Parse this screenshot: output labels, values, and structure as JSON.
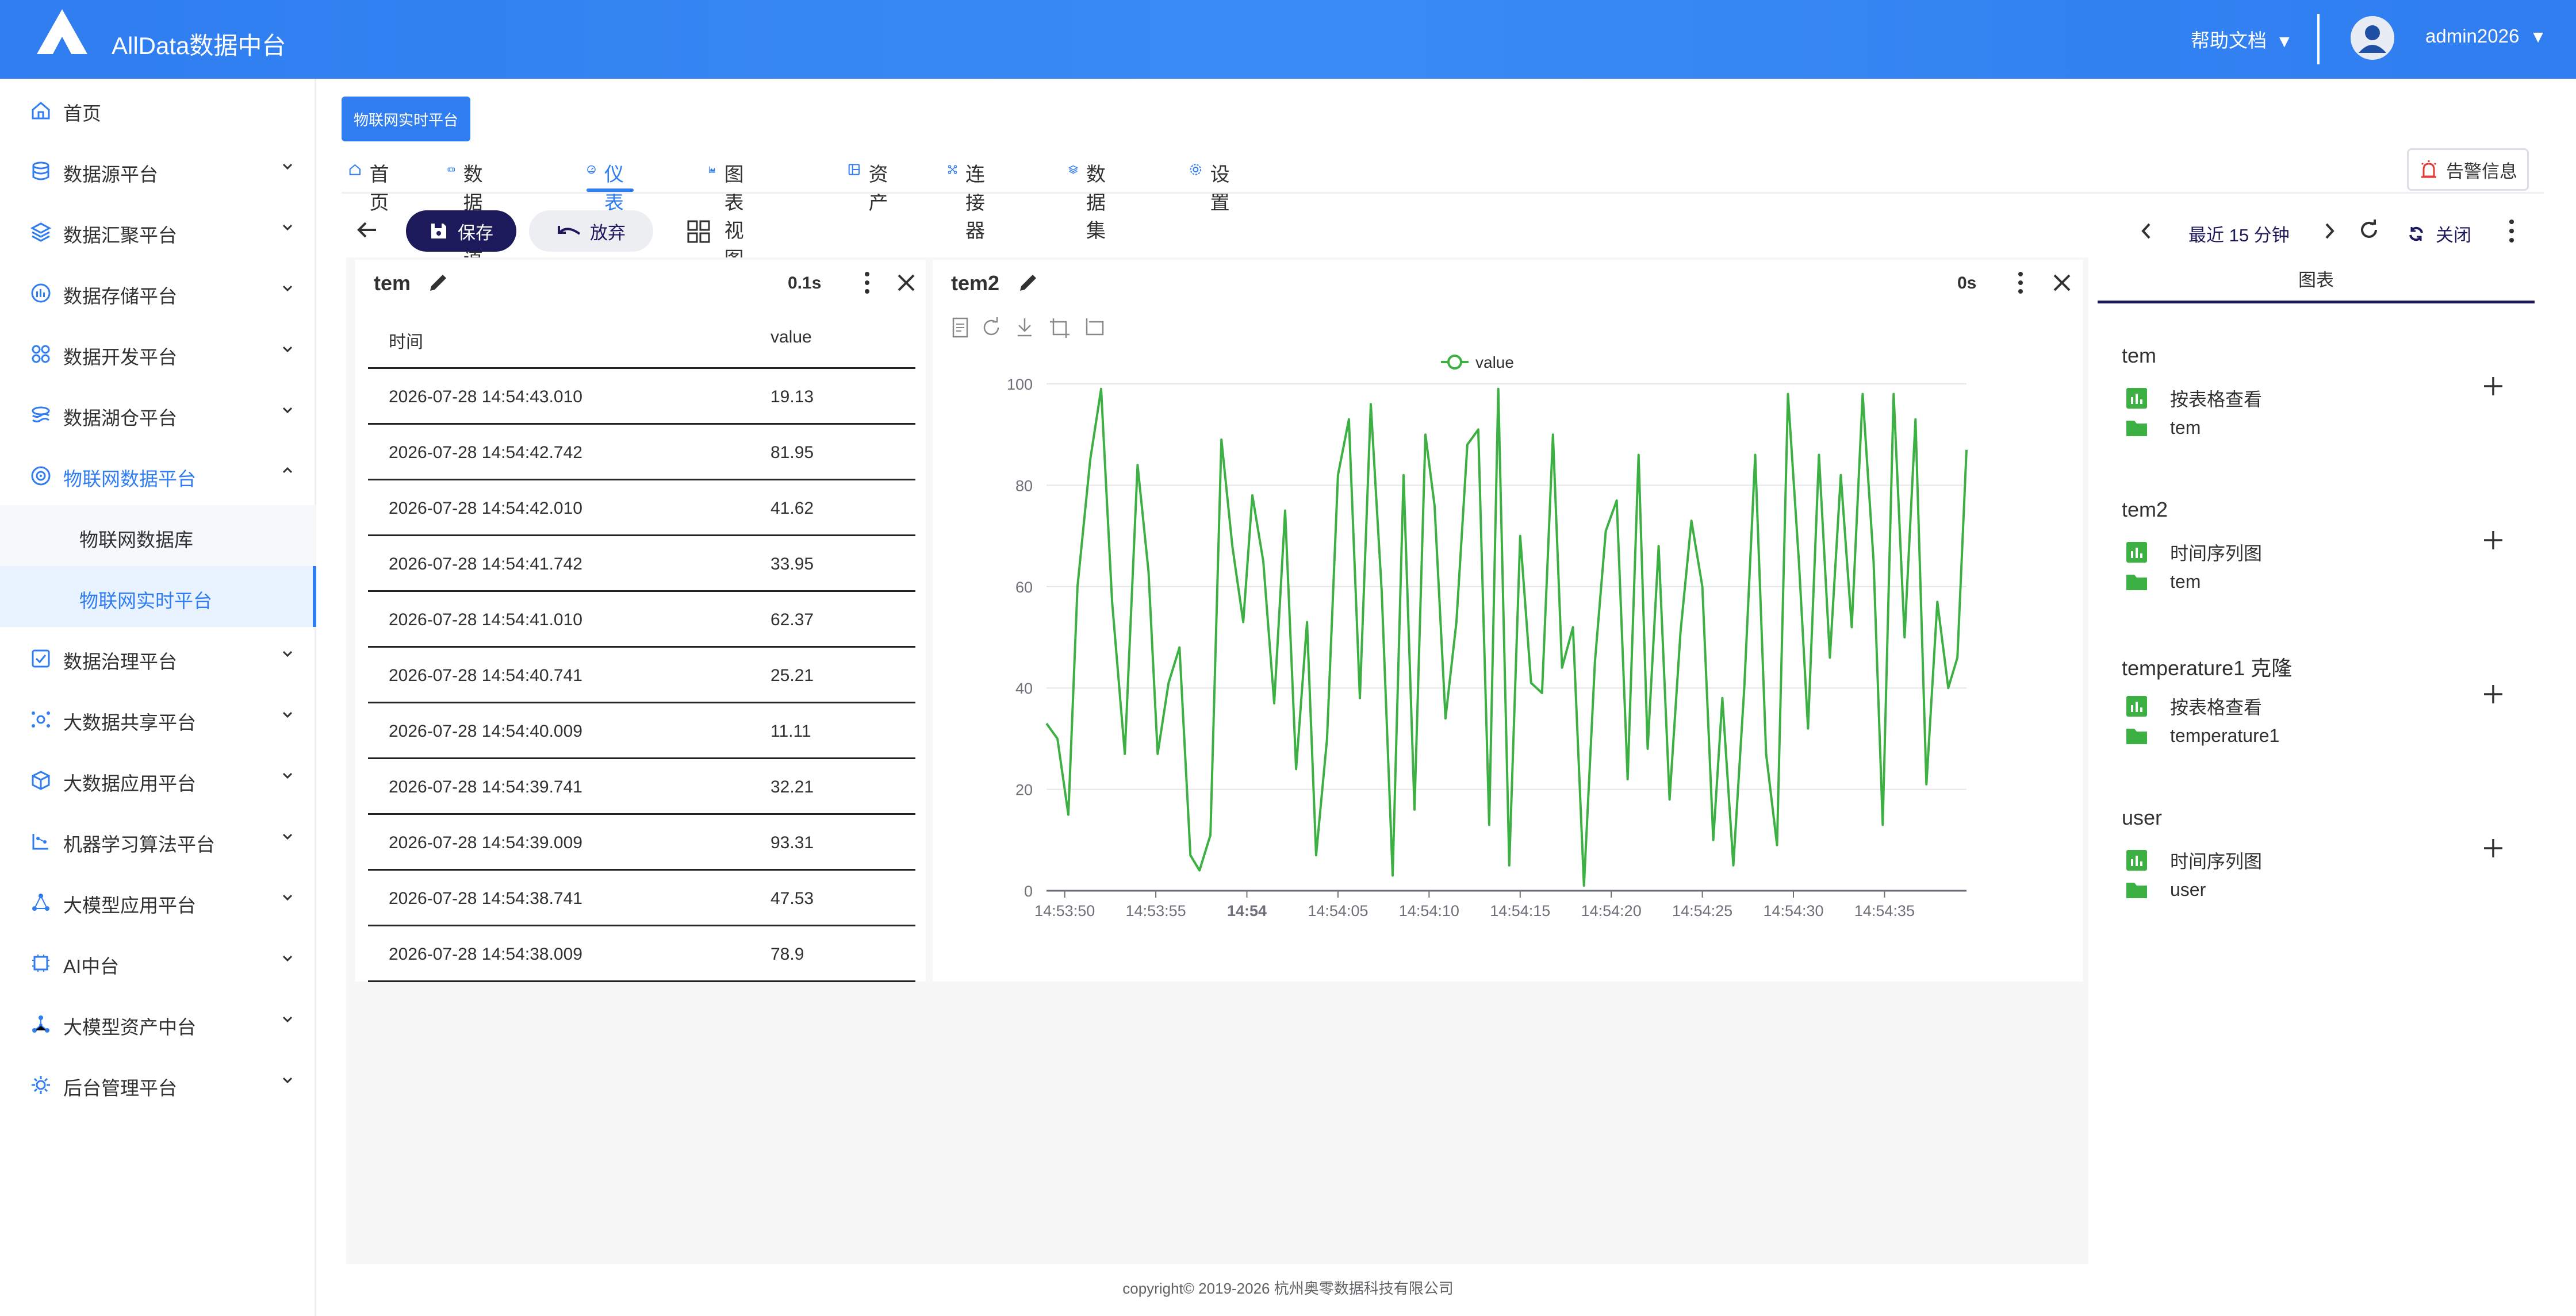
{
  "header": {
    "app_title": "AllData数据中台",
    "help_label": "帮助文档",
    "user_name": "admin2026"
  },
  "sidebar": {
    "items": [
      {
        "label": "首页",
        "icon": "home-icon"
      },
      {
        "label": "数据源平台",
        "icon": "database-icon"
      },
      {
        "label": "数据汇聚平台",
        "icon": "layers-icon"
      },
      {
        "label": "数据存储平台",
        "icon": "storage-icon"
      },
      {
        "label": "数据开发平台",
        "icon": "dev-icon"
      },
      {
        "label": "数据湖仓平台",
        "icon": "lake-icon"
      },
      {
        "label": "物联网数据平台",
        "icon": "iot-icon"
      },
      {
        "label": "物联网数据库",
        "sub": true
      },
      {
        "label": "物联网实时平台",
        "sub": true
      },
      {
        "label": "数据治理平台",
        "icon": "governance-icon"
      },
      {
        "label": "大数据共享平台",
        "icon": "share-icon"
      },
      {
        "label": "大数据应用平台",
        "icon": "cube-icon"
      },
      {
        "label": "机器学习算法平台",
        "icon": "ml-icon"
      },
      {
        "label": "大模型应用平台",
        "icon": "model-icon"
      },
      {
        "label": "AI中台",
        "icon": "ai-icon"
      },
      {
        "label": "大模型资产中台",
        "icon": "asset-icon"
      },
      {
        "label": "后台管理平台",
        "icon": "admin-icon"
      }
    ]
  },
  "page_tag": "物联网实时平台",
  "tabs": [
    {
      "label": "首页",
      "icon": "home-icon"
    },
    {
      "label": "数据管道",
      "icon": "pipeline-icon"
    },
    {
      "label": "仪表盘",
      "icon": "dashboard-icon",
      "active": true
    },
    {
      "label": "图表视图",
      "icon": "chart-icon"
    },
    {
      "label": "资产",
      "icon": "asset-icon"
    },
    {
      "label": "连接器",
      "icon": "connector-icon"
    },
    {
      "label": "数据集",
      "icon": "dataset-icon"
    },
    {
      "label": "设置",
      "icon": "gear-icon"
    }
  ],
  "alert_label": "告警信息",
  "toolbar": {
    "save_label": "保存",
    "discard_label": "放弃",
    "range_label": "最近 15 分钟",
    "close_label": "关闭"
  },
  "panel1": {
    "title": "tem",
    "time": "0.1s",
    "columns": [
      "时间",
      "value"
    ],
    "rows": [
      [
        "2026-07-28 14:54:43.010",
        "19.13"
      ],
      [
        "2026-07-28 14:54:42.742",
        "81.95"
      ],
      [
        "2026-07-28 14:54:42.010",
        "41.62"
      ],
      [
        "2026-07-28 14:54:41.742",
        "33.95"
      ],
      [
        "2026-07-28 14:54:41.010",
        "62.37"
      ],
      [
        "2026-07-28 14:54:40.741",
        "25.21"
      ],
      [
        "2026-07-28 14:54:40.009",
        "11.11"
      ],
      [
        "2026-07-28 14:54:39.741",
        "32.21"
      ],
      [
        "2026-07-28 14:54:39.009",
        "93.31"
      ],
      [
        "2026-07-28 14:54:38.741",
        "47.53"
      ],
      [
        "2026-07-28 14:54:38.009",
        "78.9"
      ]
    ]
  },
  "panel2": {
    "title": "tem2",
    "time": "0s"
  },
  "chart_data": {
    "type": "line",
    "title": "",
    "xlabel": "",
    "ylabel": "",
    "ylim": [
      0,
      100
    ],
    "yticks": [
      0,
      20,
      40,
      60,
      80,
      100
    ],
    "x_tick_labels": [
      "14:53:50",
      "14:53:55",
      "14:54",
      "14:54:05",
      "14:54:10",
      "14:54:15",
      "14:54:20",
      "14:54:25",
      "14:54:30",
      "14:54:35"
    ],
    "x_range_seconds": [
      -1,
      49.5
    ],
    "legend": "top-center",
    "grid": true,
    "color": "#3cb043",
    "series": [
      {
        "name": "value",
        "x": [
          -1,
          -0.4,
          0.2,
          0.7,
          1.4,
          2.0,
          2.6,
          3.3,
          4.0,
          4.6,
          5.1,
          5.7,
          6.3,
          6.9,
          7.4,
          8.0,
          8.6,
          9.2,
          9.8,
          10.3,
          10.9,
          11.5,
          12.1,
          12.7,
          13.3,
          13.8,
          14.4,
          15.0,
          15.6,
          16.2,
          16.8,
          17.4,
          18.0,
          18.6,
          19.2,
          19.8,
          20.3,
          20.9,
          21.5,
          22.1,
          22.7,
          23.3,
          23.8,
          24.4,
          25.0,
          25.6,
          26.2,
          26.8,
          27.3,
          27.9,
          28.5,
          29.1,
          29.7,
          30.3,
          30.9,
          31.5,
          32.0,
          32.6,
          33.2,
          33.8,
          34.4,
          35.0,
          35.6,
          36.1,
          36.7,
          37.3,
          37.9,
          38.5,
          39.1,
          39.7,
          40.3,
          40.8,
          41.4,
          42.0,
          42.6,
          43.2,
          43.8,
          44.4,
          44.9,
          45.5,
          46.1,
          46.7,
          47.3,
          47.9,
          48.5,
          49.0,
          49.5
        ],
        "values": [
          33,
          30,
          15,
          60,
          85,
          99,
          57,
          27,
          84,
          63,
          27,
          41,
          48,
          7,
          4,
          11,
          89,
          68,
          53,
          78,
          65,
          37,
          75,
          24,
          53,
          7,
          30,
          82,
          93,
          38,
          96,
          59,
          3,
          82,
          16,
          90,
          76,
          34,
          53,
          88,
          91,
          13,
          99,
          5,
          70,
          41,
          39,
          90,
          44,
          52,
          1,
          45,
          71,
          77,
          22,
          86,
          28,
          68,
          18,
          51,
          73,
          60,
          10,
          38,
          5,
          40,
          86,
          27,
          9,
          98,
          65,
          32,
          86,
          46,
          82,
          52,
          98,
          65,
          13,
          98,
          50,
          93,
          21,
          57,
          40,
          46,
          87
        ]
      }
    ]
  },
  "right_panel": {
    "tab_label": "图表",
    "groups": [
      {
        "name": "tem",
        "view": "按表格查看",
        "source": "tem"
      },
      {
        "name": "tem2",
        "view": "时间序列图",
        "source": "tem"
      },
      {
        "name": "temperature1 克隆",
        "view": "按表格查看",
        "source": "temperature1"
      },
      {
        "name": "user",
        "view": "时间序列图",
        "source": "user"
      }
    ]
  },
  "footer": "copyright© 2019-2026 杭州奥零数据科技有限公司"
}
